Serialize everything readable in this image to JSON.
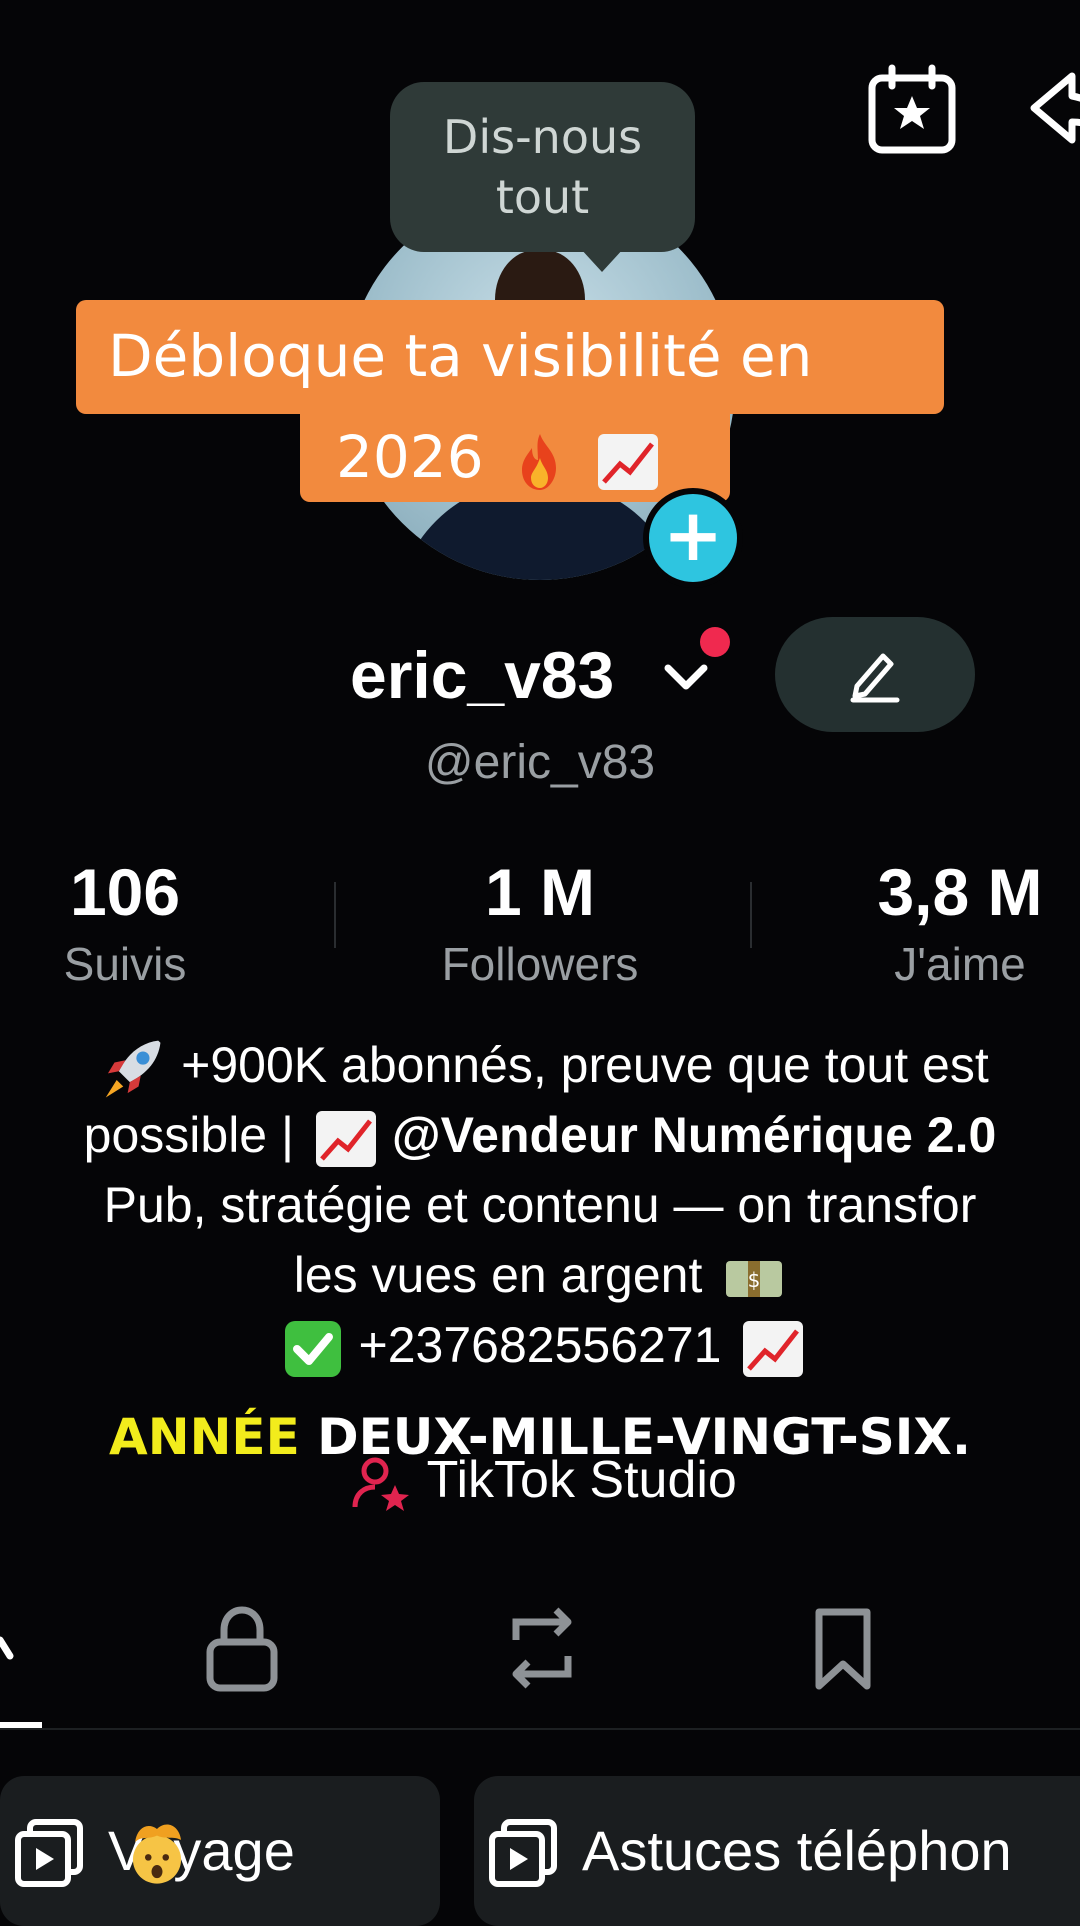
{
  "header": {
    "calendar_icon": "calendar-star-icon",
    "share_icon": "share-icon"
  },
  "profile": {
    "tooltip": "Dis-nous tout",
    "username": "eric_v83",
    "handle": "@eric_v83",
    "add_icon": "+"
  },
  "overlay": {
    "banner_line1": "Débloque ta visibilité en",
    "banner_line2": "2026",
    "subtitle_highlight": "ANNÉE",
    "subtitle_rest": " DEUX-MILLE-VINGT-SIX."
  },
  "stats": [
    {
      "value": "106",
      "label": "Suivis"
    },
    {
      "value": "1 M",
      "label": "Followers"
    },
    {
      "value": "3,8 M",
      "label": "J'aime"
    }
  ],
  "bio": {
    "line1": "+900K abonnés, preuve que tout est",
    "line2_a": "possible |",
    "line2_mention": "@Vendeur Numérique 2.0",
    "line3": "Pub, stratégie et contenu — on transfor",
    "line4": "les vues en argent",
    "line5": "+237682556271",
    "studio": "TikTok Studio"
  },
  "tabs": [
    "videos-tab",
    "private-tab",
    "reposts-tab",
    "favorites-tab"
  ],
  "playlists": [
    {
      "label": "Voyage"
    },
    {
      "label": "Astuces téléphon"
    }
  ],
  "colors": {
    "banner": "#f28a3e",
    "accent_cyan": "#2ec5e0",
    "notification": "#f0294f",
    "subtitle_highlight": "#f2ec1c"
  }
}
